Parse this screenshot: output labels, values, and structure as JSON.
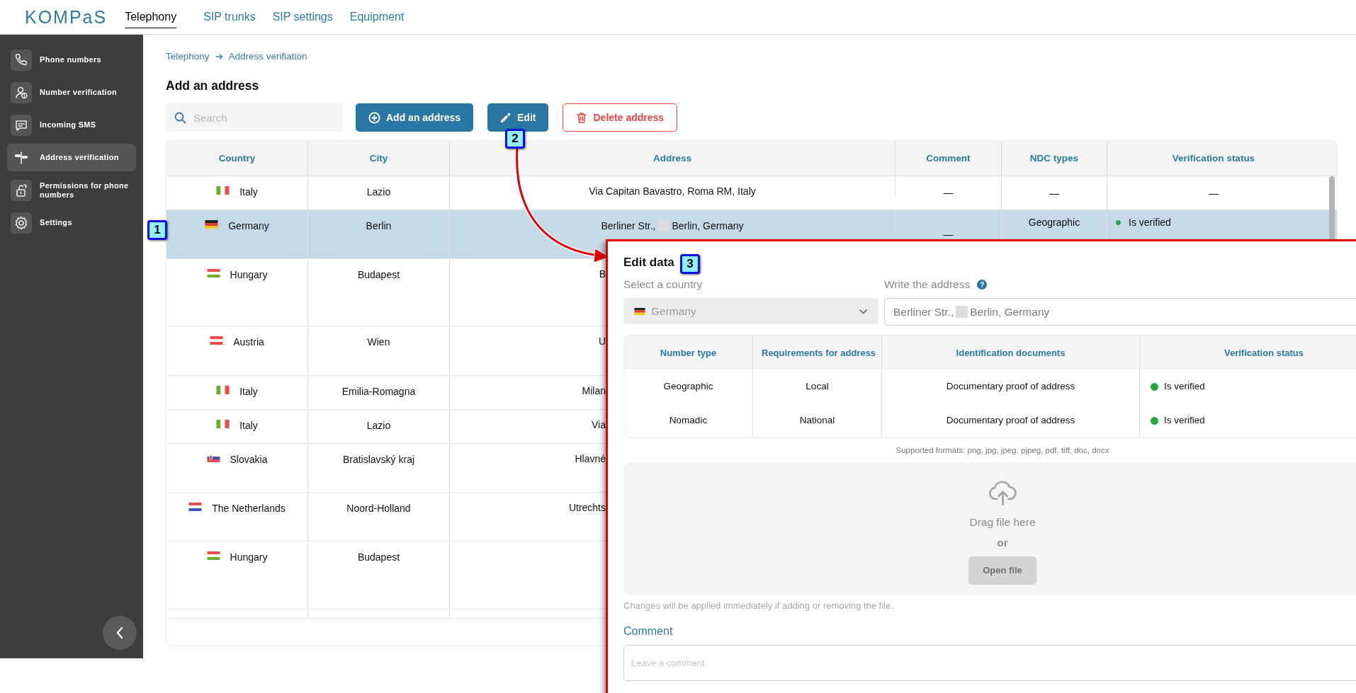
{
  "header": {
    "logo": "KOMPaS",
    "tabs": [
      {
        "label": "Telephony",
        "selected": true
      },
      {
        "label": "SIP trunks",
        "selected": false
      },
      {
        "label": "SIP settings",
        "selected": false
      },
      {
        "label": "Equipment",
        "selected": false
      }
    ]
  },
  "sidebar": {
    "items": [
      {
        "label": "Phone numbers",
        "selected": false
      },
      {
        "label": "Number verification",
        "selected": false
      },
      {
        "label": "Incoming SMS",
        "selected": false
      },
      {
        "label": "Address verification",
        "selected": true
      },
      {
        "label": "Permissions for phone numbers",
        "selected": false
      },
      {
        "label": "Settings",
        "selected": false
      }
    ]
  },
  "breadcrumb": [
    "Telephony",
    "Address verifiation"
  ],
  "title": "Add an address",
  "search": {
    "placeholder": "Search"
  },
  "buttons": [
    {
      "label": "Add an address",
      "kind": "primary"
    },
    {
      "label": "Edit",
      "kind": "primary"
    },
    {
      "label": "Delete address",
      "kind": "danger"
    }
  ],
  "table": {
    "columns": [
      "Country",
      "City",
      "Address",
      "Comment",
      "NDC types",
      "Verification status"
    ],
    "rows": [
      {
        "kind": "it",
        "country": "Italy",
        "city": "Lazio",
        "address": [
          "Via Capitan Bavastro, Roma RM, Italy"
        ],
        "comment": "—",
        "ndc_types": [
          "—"
        ],
        "verification": [
          {
            "text": "—"
          }
        ],
        "selected": false
      },
      {
        "kind": "de",
        "country": "Germany",
        "city": "Berlin",
        "address": [
          "Berliner Str.,",
          "Berlin, Germany"
        ],
        "comment": "—",
        "ndc_types": [
          "Geographic"
        ],
        "verification": [
          {
            "text": "Is verified",
            "color": "#28a745"
          }
        ],
        "selected": true
      },
      {
        "kind": "hu",
        "country": "Hungary",
        "city": "Budapest",
        "address": [
          "B"
        ],
        "selected": false
      },
      {
        "kind": "at",
        "country": "Austria",
        "city": "Wien",
        "address": [
          "U"
        ],
        "selected": false
      },
      {
        "kind": "it",
        "country": "Italy",
        "city": "Emilia-Romagna",
        "address": [
          "Milan"
        ],
        "selected": false
      },
      {
        "kind": "it",
        "country": "Italy",
        "city": "Lazio",
        "address": [
          "Via"
        ],
        "selected": false
      },
      {
        "kind": "sk",
        "country": "Slovakia",
        "city": "Bratislavský kraj",
        "address": [
          "Hlavné"
        ],
        "selected": false
      },
      {
        "kind": "nl",
        "country": "The Netherlands",
        "city": "Noord-Holland",
        "address": [
          "Utrechts"
        ],
        "selected": false
      },
      {
        "kind": "hu",
        "country": "Hungary",
        "city": "Budapest",
        "selected": false
      }
    ]
  },
  "edit_panel": {
    "title": "Edit data",
    "country_label": "Select a country",
    "country": {
      "kind": "de",
      "value": "Germany",
      "disabled": true
    },
    "address_label": "Write the address",
    "help": "?",
    "address_value": [
      "Berliner Str.,",
      "Berlin, Germany"
    ],
    "table": {
      "columns": [
        "Number type",
        "Requirements for address",
        "Identification documents",
        "Verification status"
      ],
      "rows": [
        {
          "number_type": "Geographic",
          "requirements": "Local",
          "documents": "Documentary proof of address",
          "status": "Is verified",
          "color": "#28a745"
        },
        {
          "number_type": "Nomadic",
          "requirements": "National",
          "documents": "Documentary proof of address",
          "status": "Is verified",
          "color": "#28a745"
        }
      ]
    },
    "formats": "Supported formats: png, jpg, jpeg, pjpeg, pdf, tiff, doc, docx",
    "dropzone": {
      "text": "Drag file here",
      "or": "or",
      "button": "Open file",
      "button_disabled": true
    },
    "note": "Changes will be applied immediately if adding or removing the file.",
    "comment_label": "Comment",
    "comment": {
      "placeholder": "Leave a comment"
    }
  },
  "annotations": {
    "markers": [
      "1",
      "2",
      "3"
    ]
  }
}
